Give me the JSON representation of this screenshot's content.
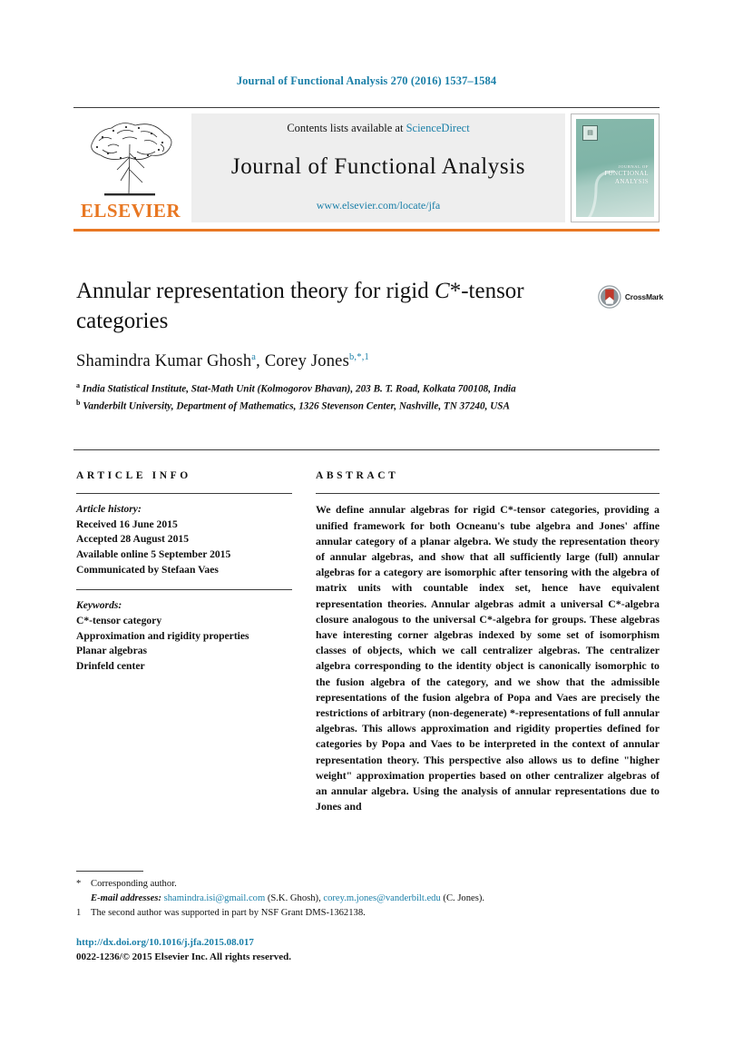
{
  "running_head": "Journal of Functional Analysis 270 (2016) 1537–1584",
  "masthead": {
    "contents_prefix": "Contents lists available at ",
    "sciencedirect": "ScienceDirect",
    "journal_name": "Journal of Functional Analysis",
    "journal_url": "www.elsevier.com/locate/jfa",
    "publisher": "ELSEVIER",
    "accent_color": "#e87722",
    "link_color": "#1a7fa8",
    "cover": {
      "title_small": "JOURNAL OF",
      "title_line1": "FUNCTIONAL",
      "title_line2": "ANALYSIS",
      "bg_color": "#86b8ab"
    }
  },
  "article": {
    "title_part1": "Annular representation theory for rigid ",
    "title_italic": "C",
    "title_part2": "*-tensor categories",
    "crossmark_label": "CrossMark",
    "authors": [
      {
        "name": "Shamindra Kumar Ghosh",
        "marks": "a"
      },
      {
        "name": "Corey Jones",
        "marks": "b,*,1"
      }
    ],
    "authors_line": "Shamindra Kumar Ghosh",
    "author2": "Corey Jones",
    "affiliations": [
      {
        "marker": "a",
        "text": "India Statistical Institute, Stat-Math Unit (Kolmogorov Bhavan), 203 B. T. Road, Kolkata 700108, India"
      },
      {
        "marker": "b",
        "text": "Vanderbilt University, Department of Mathematics, 1326 Stevenson Center, Nashville, TN 37240, USA"
      }
    ]
  },
  "article_info": {
    "heading": "ARTICLE INFO",
    "history_label": "Article history:",
    "received": "Received 16 June 2015",
    "accepted": "Accepted 28 August 2015",
    "available_online": "Available online 5 September 2015",
    "communicated_by": "Communicated by Stefaan Vaes",
    "keywords_label": "Keywords:",
    "keywords": [
      "C*-tensor category",
      "Approximation and rigidity properties",
      "Planar algebras",
      "Drinfeld center"
    ]
  },
  "abstract": {
    "heading": "ABSTRACT",
    "text": "We define annular algebras for rigid C*-tensor categories, providing a unified framework for both Ocneanu's tube algebra and Jones' affine annular category of a planar algebra. We study the representation theory of annular algebras, and show that all sufficiently large (full) annular algebras for a category are isomorphic after tensoring with the algebra of matrix units with countable index set, hence have equivalent representation theories. Annular algebras admit a universal C*-algebra closure analogous to the universal C*-algebra for groups. These algebras have interesting corner algebras indexed by some set of isomorphism classes of objects, which we call centralizer algebras. The centralizer algebra corresponding to the identity object is canonically isomorphic to the fusion algebra of the category, and we show that the admissible representations of the fusion algebra of Popa and Vaes are precisely the restrictions of arbitrary (non-degenerate) *-representations of full annular algebras. This allows approximation and rigidity properties defined for categories by Popa and Vaes to be interpreted in the context of annular representation theory. This perspective also allows us to define \"higher weight\" approximation properties based on other centralizer algebras of an annular algebra. Using the analysis of annular representations due to Jones and"
  },
  "footnotes": {
    "corresponding_marker": "*",
    "corresponding_text": "Corresponding author.",
    "email_label": "E-mail addresses:",
    "email1": "shamindra.isi@gmail.com",
    "email1_owner": "(S.K. Ghosh),",
    "email2": "corey.m.jones@vanderbilt.edu",
    "email2_owner": "(C. Jones).",
    "note_marker": "1",
    "note_text": "The second author was supported in part by NSF Grant DMS-1362138."
  },
  "footer": {
    "doi": "http://dx.doi.org/10.1016/j.jfa.2015.08.017",
    "rights": "0022-1236/© 2015 Elsevier Inc. All rights reserved."
  }
}
